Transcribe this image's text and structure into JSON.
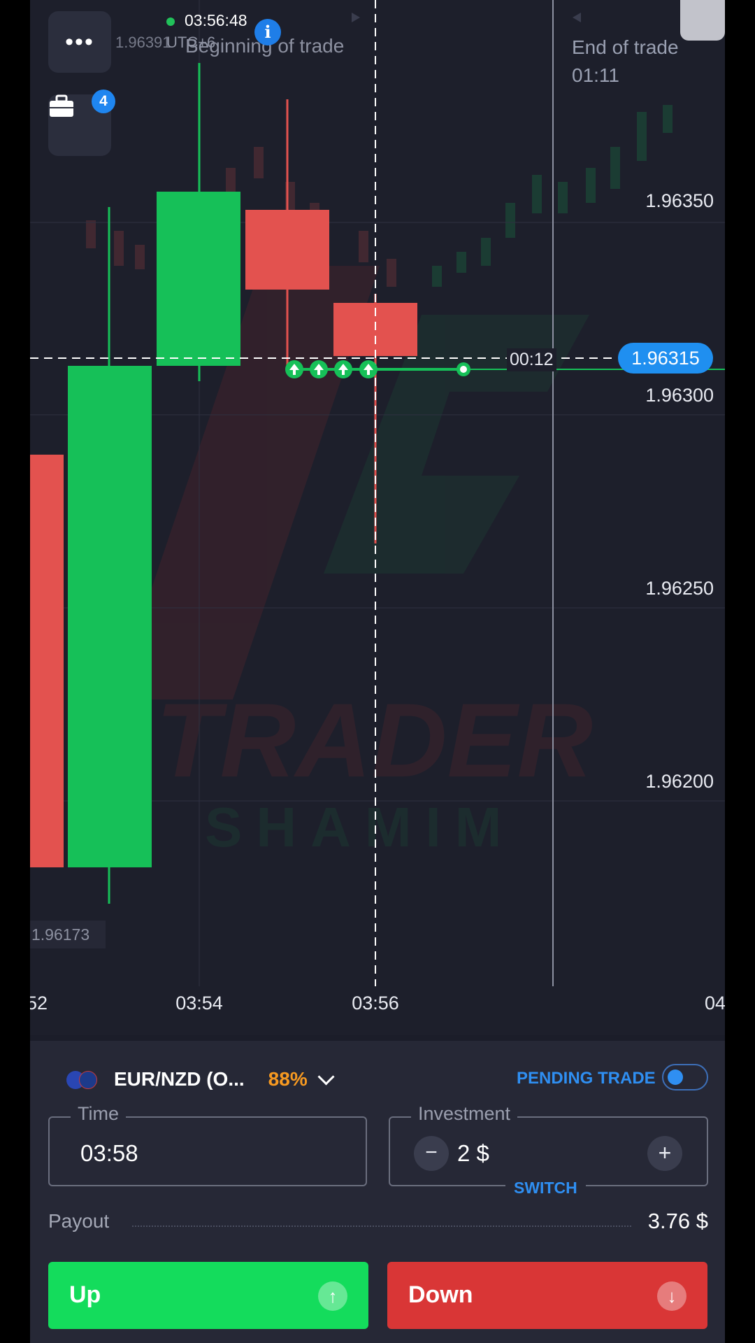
{
  "status": {
    "clock": "03:56:48",
    "timezone": "UTC+6",
    "prev_price_ghost": "1.96391"
  },
  "portfolio": {
    "badge_count": "4"
  },
  "chart": {
    "beginning_label": "Beginning of trade",
    "end_label": "End of trade",
    "end_time": "01:11",
    "countdown": "00:12",
    "current_price": "1.96315",
    "low_marker": "1.96173",
    "price_labels": [
      "1.96350",
      "1.96300",
      "1.96250",
      "1.96200"
    ],
    "time_labels": [
      "52",
      "03:54",
      "03:56",
      "04"
    ],
    "colors": {
      "bull": "#16c058",
      "bear": "#e3524f",
      "accent": "#1f8ff0"
    }
  },
  "asset": {
    "name": "EUR/NZD (O...",
    "payout_pct": "88%",
    "pending_label": "PENDING TRADE"
  },
  "time_field": {
    "label": "Time",
    "value": "03:58"
  },
  "investment_field": {
    "label": "Investment",
    "minus": "−",
    "value": "2 $",
    "plus": "+",
    "switch_label": "SWITCH"
  },
  "payout": {
    "label": "Payout",
    "value": "3.76 $"
  },
  "actions": {
    "up_label": "Up",
    "down_label": "Down",
    "up_icon": "↑",
    "down_icon": "↓"
  }
}
